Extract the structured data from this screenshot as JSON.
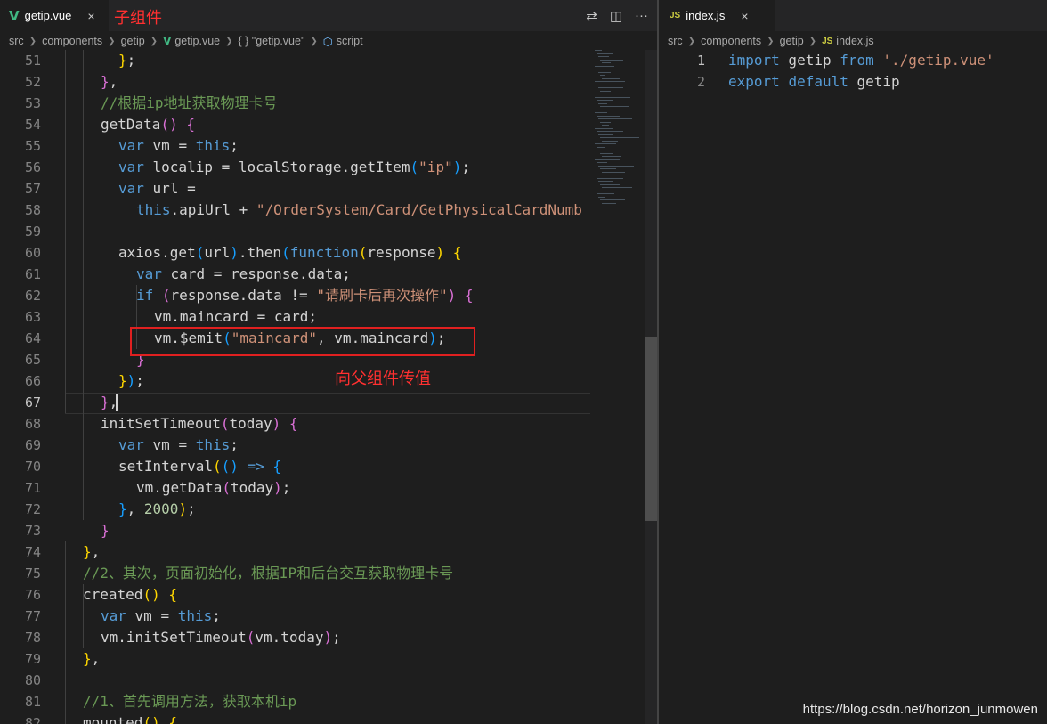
{
  "left_editor": {
    "tab": {
      "label": "getip.vue",
      "close": "×"
    },
    "annotation_child": "子组件",
    "annotation_emit": "向父组件传值",
    "toolbar": {
      "compare": "⇄",
      "split": "◫",
      "more": "···"
    },
    "breadcrumb": [
      "src",
      "components",
      "getip",
      "getip.vue",
      "{ } \"getip.vue\"",
      "script"
    ],
    "lines": [
      {
        "n": "51",
        "ind": 2,
        "t": [
          [
            "p2",
            "}"
          ],
          [
            "",
            ";"
          ]
        ]
      },
      {
        "n": "52",
        "ind": 1,
        "t": [
          [
            "p1",
            "}"
          ],
          [
            "",
            ","
          ]
        ]
      },
      {
        "n": "53",
        "ind": 1,
        "t": [
          [
            "cm",
            "//根据ip地址获取物理卡号"
          ]
        ]
      },
      {
        "n": "54",
        "ind": 1,
        "t": [
          [
            "",
            "getData"
          ],
          [
            "p1",
            "()"
          ],
          [
            "",
            " "
          ],
          [
            "p1",
            "{"
          ]
        ]
      },
      {
        "n": "55",
        "ind": 2,
        "t": [
          [
            "kw",
            "var"
          ],
          [
            "",
            " vm = "
          ],
          [
            "kw",
            "this"
          ],
          [
            "",
            ";"
          ]
        ]
      },
      {
        "n": "56",
        "ind": 2,
        "t": [
          [
            "kw",
            "var"
          ],
          [
            "",
            " localip = localStorage.getItem"
          ],
          [
            "p3",
            "("
          ],
          [
            "str",
            "\"ip\""
          ],
          [
            "p3",
            ")"
          ],
          [
            "",
            ";"
          ]
        ]
      },
      {
        "n": "57",
        "ind": 2,
        "t": [
          [
            "kw",
            "var"
          ],
          [
            "",
            " url ="
          ]
        ]
      },
      {
        "n": "58",
        "ind": 3,
        "t": [
          [
            "kw",
            "this"
          ],
          [
            "",
            ".apiUrl + "
          ],
          [
            "str",
            "\"/OrderSystem/Card/GetPhysicalCardNumb"
          ]
        ]
      },
      {
        "n": "59",
        "ind": 0,
        "t": []
      },
      {
        "n": "60",
        "ind": 2,
        "t": [
          [
            "",
            "axios.get"
          ],
          [
            "p3",
            "("
          ],
          [
            "",
            "url"
          ],
          [
            "p3",
            ")"
          ],
          [
            "",
            ".then"
          ],
          [
            "p3",
            "("
          ],
          [
            "kw",
            "function"
          ],
          [
            "p2",
            "("
          ],
          [
            "",
            "response"
          ],
          [
            "p2",
            ")"
          ],
          [
            "",
            " "
          ],
          [
            "p2",
            "{"
          ]
        ]
      },
      {
        "n": "61",
        "ind": 3,
        "t": [
          [
            "kw",
            "var"
          ],
          [
            "",
            " card = response.data;"
          ]
        ]
      },
      {
        "n": "62",
        "ind": 3,
        "t": [
          [
            "kw",
            "if"
          ],
          [
            "",
            " "
          ],
          [
            "p1",
            "("
          ],
          [
            "",
            "response.data != "
          ],
          [
            "str",
            "\"请刷卡后再次操作\""
          ],
          [
            "p1",
            ")"
          ],
          [
            "",
            " "
          ],
          [
            "p1",
            "{"
          ]
        ]
      },
      {
        "n": "63",
        "ind": 4,
        "t": [
          [
            "",
            "vm.maincard = card;"
          ]
        ]
      },
      {
        "n": "64",
        "ind": 4,
        "t": [
          [
            "",
            "vm.$emit"
          ],
          [
            "p3",
            "("
          ],
          [
            "str",
            "\"maincard\""
          ],
          [
            "",
            ", vm.maincard"
          ],
          [
            "p3",
            ")"
          ],
          [
            "",
            ";"
          ]
        ]
      },
      {
        "n": "65",
        "ind": 3,
        "t": [
          [
            "p1",
            "}"
          ]
        ]
      },
      {
        "n": "66",
        "ind": 2,
        "t": [
          [
            "p2",
            "}"
          ],
          [
            "p3",
            ")"
          ],
          [
            "",
            ";"
          ]
        ]
      },
      {
        "n": "67",
        "ind": 1,
        "t": [
          [
            "p1",
            "}"
          ],
          [
            "",
            ","
          ]
        ]
      },
      {
        "n": "68",
        "ind": 1,
        "t": [
          [
            "",
            "initSetTimeout"
          ],
          [
            "p1",
            "("
          ],
          [
            "",
            "today"
          ],
          [
            "p1",
            ")"
          ],
          [
            "",
            " "
          ],
          [
            "p1",
            "{"
          ]
        ]
      },
      {
        "n": "69",
        "ind": 2,
        "t": [
          [
            "kw",
            "var"
          ],
          [
            "",
            " vm = "
          ],
          [
            "kw",
            "this"
          ],
          [
            "",
            ";"
          ]
        ]
      },
      {
        "n": "70",
        "ind": 2,
        "t": [
          [
            "",
            "setInterval"
          ],
          [
            "p2",
            "("
          ],
          [
            "p3",
            "()"
          ],
          [
            "",
            " "
          ],
          [
            "kw",
            "=>"
          ],
          [
            "",
            " "
          ],
          [
            "p3",
            "{"
          ]
        ]
      },
      {
        "n": "71",
        "ind": 3,
        "t": [
          [
            "",
            "vm.getData"
          ],
          [
            "p1",
            "("
          ],
          [
            "",
            "today"
          ],
          [
            "p1",
            ")"
          ],
          [
            "",
            ";"
          ]
        ]
      },
      {
        "n": "72",
        "ind": 2,
        "t": [
          [
            "p3",
            "}"
          ],
          [
            "",
            ", "
          ],
          [
            "num",
            "2000"
          ],
          [
            "p2",
            ")"
          ],
          [
            "",
            ";"
          ]
        ]
      },
      {
        "n": "73",
        "ind": 1,
        "t": [
          [
            "p1",
            "}"
          ]
        ]
      },
      {
        "n": "74",
        "ind": 0,
        "t": [
          [
            "p2",
            "}"
          ],
          [
            "",
            ","
          ]
        ]
      },
      {
        "n": "75",
        "ind": 0,
        "t": [
          [
            "cm",
            "//2、其次，页面初始化，根据IP和后台交互获取物理卡号"
          ]
        ]
      },
      {
        "n": "76",
        "ind": 0,
        "t": [
          [
            "",
            "created"
          ],
          [
            "p2",
            "()"
          ],
          [
            "",
            " "
          ],
          [
            "p2",
            "{"
          ]
        ]
      },
      {
        "n": "77",
        "ind": 1,
        "t": [
          [
            "kw",
            "var"
          ],
          [
            "",
            " vm = "
          ],
          [
            "kw",
            "this"
          ],
          [
            "",
            ";"
          ]
        ]
      },
      {
        "n": "78",
        "ind": 1,
        "t": [
          [
            "",
            "vm.initSetTimeout"
          ],
          [
            "p1",
            "("
          ],
          [
            "",
            "vm.today"
          ],
          [
            "p1",
            ")"
          ],
          [
            "",
            ";"
          ]
        ]
      },
      {
        "n": "79",
        "ind": 0,
        "t": [
          [
            "p2",
            "}"
          ],
          [
            "",
            ","
          ]
        ]
      },
      {
        "n": "80",
        "ind": 0,
        "t": []
      },
      {
        "n": "81",
        "ind": 0,
        "t": [
          [
            "cm",
            "//1、首先调用方法，获取本机ip"
          ]
        ]
      },
      {
        "n": "82",
        "ind": 0,
        "t": [
          [
            "",
            "mounted"
          ],
          [
            "p2",
            "()"
          ],
          [
            "",
            " "
          ],
          [
            "p2",
            "{"
          ]
        ]
      }
    ]
  },
  "right_editor": {
    "tab": {
      "label": "index.js",
      "close": "×",
      "badge": "JS"
    },
    "breadcrumb": [
      "src",
      "components",
      "getip",
      "index.js"
    ],
    "lines": [
      {
        "n": "1",
        "t": [
          [
            "kw",
            "import"
          ],
          [
            "",
            " getip "
          ],
          [
            "kw",
            "from"
          ],
          [
            "",
            " "
          ],
          [
            "str",
            "'./getip.vue'"
          ]
        ]
      },
      {
        "n": "2",
        "t": [
          [
            "kw",
            "export"
          ],
          [
            "",
            " "
          ],
          [
            "kw",
            "default"
          ],
          [
            "",
            " getip"
          ]
        ]
      }
    ]
  },
  "watermark": "https://blog.csdn.net/horizon_junmowen",
  "colors": {
    "keyword": "#569cd6",
    "string": "#ce9178",
    "comment": "#6a9955",
    "annotation": "#ff3030"
  }
}
